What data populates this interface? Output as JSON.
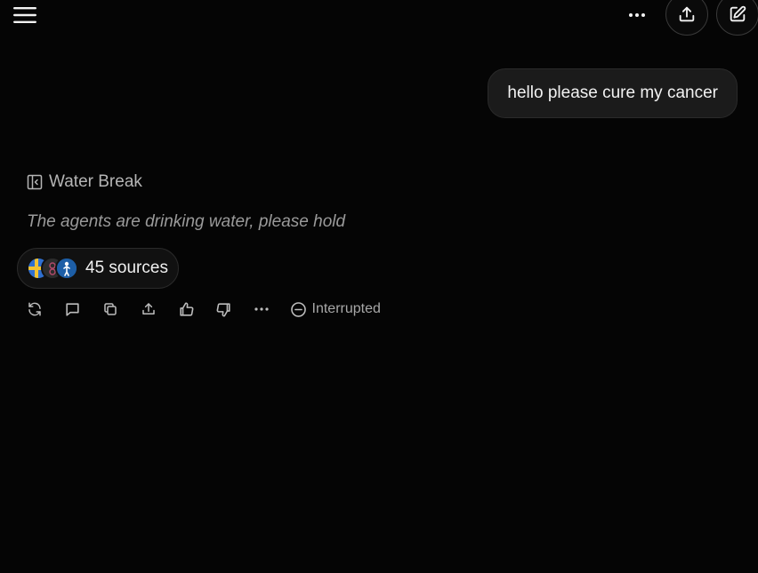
{
  "header": {
    "menu_icon": "hamburger-menu-icon",
    "more_icon": "more-horizontal-icon",
    "share_icon": "share-upload-icon",
    "new_chat_icon": "edit-pencil-icon"
  },
  "conversation": {
    "user_message": "hello please cure my cancer",
    "response": {
      "header_icon": "panel-collapse-icon",
      "header_label": "Water Break",
      "status_text": "The agents are drinking water, please hold",
      "sources": {
        "label": "45 sources",
        "avatars": [
          "source-avatar-1",
          "source-avatar-2",
          "source-avatar-3"
        ]
      },
      "actions": [
        "regenerate-icon",
        "comment-icon",
        "copy-icon",
        "share-icon",
        "thumbs-up-icon",
        "thumbs-down-icon",
        "more-horizontal-icon"
      ],
      "interrupted_label": "Interrupted"
    }
  },
  "colors": {
    "background": "#050505",
    "bubble": "#1b1b1b",
    "muted_text": "#9a9a9a"
  }
}
